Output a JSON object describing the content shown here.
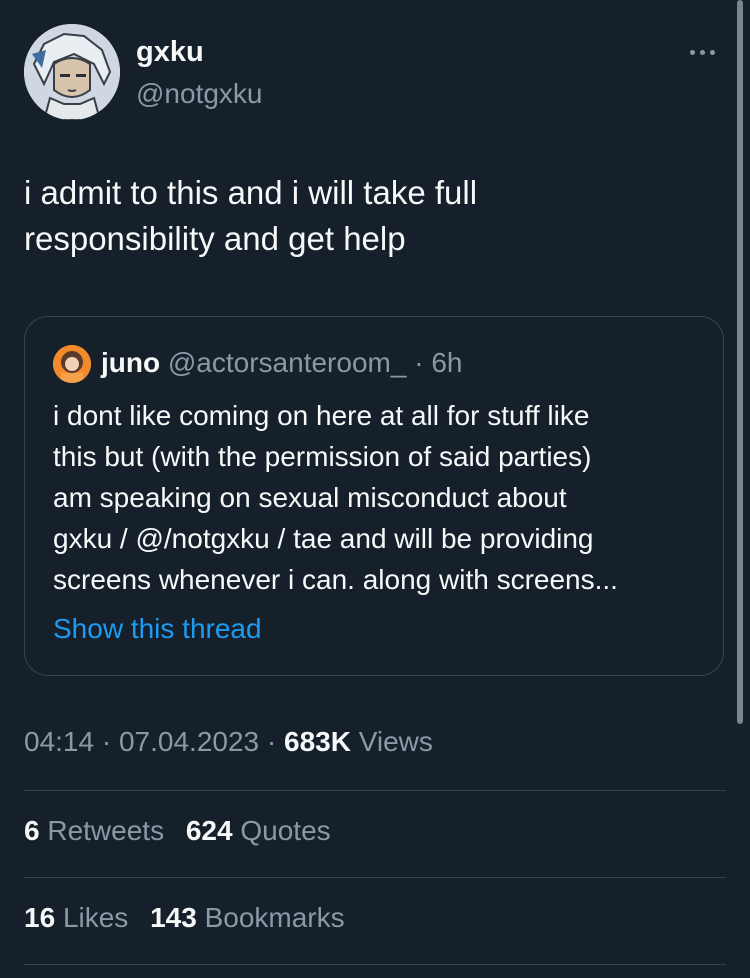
{
  "author": {
    "name": "gxku",
    "handle": "@notgxku"
  },
  "tweet": {
    "text": "i admit to this and i will take full\nresponsibility and get help"
  },
  "quoted_tweet": {
    "name": "juno",
    "handle": "@actorsanteroom_",
    "separator": "·",
    "time": "6h",
    "text": "i dont like coming on here at all for stuff like\nthis but (with the permission of said parties)\nam speaking on sexual misconduct about\ngxku / @/notgxku / tae and will be providing\nscreens whenever i can. along with screens...",
    "show_thread": "Show this thread"
  },
  "meta": {
    "time": "04:14",
    "sep1": "·",
    "date": "07.04.2023",
    "sep2": "·",
    "views_count": "683K",
    "views_label": "Views"
  },
  "stats_row1": {
    "retweets_count": "6",
    "retweets_label": "Retweets",
    "quotes_count": "624",
    "quotes_label": "Quotes"
  },
  "stats_row2": {
    "likes_count": "16",
    "likes_label": "Likes",
    "bookmarks_count": "143",
    "bookmarks_label": "Bookmarks"
  },
  "icons": {
    "more": "more-options-icon"
  },
  "colors": {
    "background": "#15202b",
    "text": "#f7f9f9",
    "secondary": "#8b98a5",
    "link": "#1d9bf0",
    "border": "#38444d"
  }
}
